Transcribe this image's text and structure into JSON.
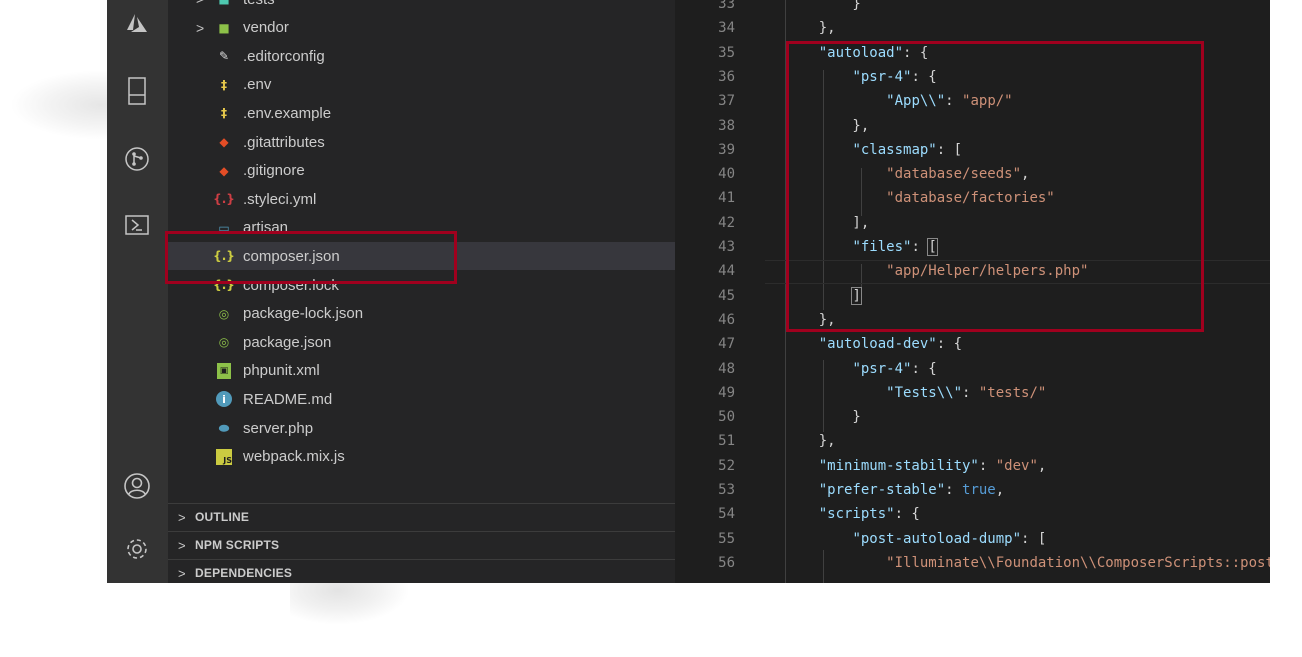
{
  "explorer": {
    "files": [
      {
        "name": "tests",
        "icon": "folder-tests-icon",
        "type": "folder",
        "color": "#4ec9b0"
      },
      {
        "name": "vendor",
        "icon": "folder-vendor-icon",
        "type": "folder",
        "color": "#8dc149"
      },
      {
        "name": ".editorconfig",
        "icon": "editorconfig-icon",
        "type": "file",
        "color": "#dddddd"
      },
      {
        "name": ".env",
        "icon": "env-icon",
        "type": "file",
        "color": "#e6c84b"
      },
      {
        "name": ".env.example",
        "icon": "env-icon",
        "type": "file",
        "color": "#e6c84b"
      },
      {
        "name": ".gitattributes",
        "icon": "git-icon",
        "type": "file",
        "color": "#e44d26"
      },
      {
        "name": ".gitignore",
        "icon": "git-icon",
        "type": "file",
        "color": "#e44d26"
      },
      {
        "name": ".styleci.yml",
        "icon": "yaml-icon",
        "type": "file",
        "color": "#cc3e44"
      },
      {
        "name": "artisan",
        "icon": "file-icon",
        "type": "file",
        "color": "#519aba"
      },
      {
        "name": "composer.json",
        "icon": "json-icon",
        "type": "file",
        "color": "#cbcb41",
        "selected": true
      },
      {
        "name": "composer.lock",
        "icon": "json-icon",
        "type": "file",
        "color": "#cbcb41"
      },
      {
        "name": "package-lock.json",
        "icon": "npm-json-icon",
        "type": "file",
        "color": "#8dc149"
      },
      {
        "name": "package.json",
        "icon": "npm-json-icon",
        "type": "file",
        "color": "#8dc149"
      },
      {
        "name": "phpunit.xml",
        "icon": "xml-icon",
        "type": "file",
        "color": "#8dc149"
      },
      {
        "name": "README.md",
        "icon": "info-icon",
        "type": "file",
        "color": "#519aba"
      },
      {
        "name": "server.php",
        "icon": "php-icon",
        "type": "file",
        "color": "#519aba"
      },
      {
        "name": "webpack.mix.js",
        "icon": "js-icon",
        "type": "file",
        "color": "#cbcb41"
      }
    ],
    "panels": [
      "OUTLINE",
      "NPM SCRIPTS",
      "DEPENDENCIES"
    ]
  },
  "activity_bar": [
    "azure-icon",
    "remote-explorer-icon",
    "git-source-control-icon",
    "terminal-icon",
    "account-icon",
    "settings-gear-icon"
  ],
  "editor": {
    "lines": [
      {
        "n": "33",
        "text": "        }"
      },
      {
        "n": "34",
        "text": "    },"
      },
      {
        "n": "35",
        "text": "    \"autoload\": {"
      },
      {
        "n": "36",
        "text": "        \"psr-4\": {"
      },
      {
        "n": "37",
        "text": "            \"App\\\\\": \"app/\""
      },
      {
        "n": "38",
        "text": "        },"
      },
      {
        "n": "39",
        "text": "        \"classmap\": ["
      },
      {
        "n": "40",
        "text": "            \"database/seeds\","
      },
      {
        "n": "41",
        "text": "            \"database/factories\""
      },
      {
        "n": "42",
        "text": "        ],"
      },
      {
        "n": "43",
        "text": "        \"files\": ["
      },
      {
        "n": "44",
        "text": "            \"app/Helper/helpers.php\""
      },
      {
        "n": "45",
        "text": "        ]"
      },
      {
        "n": "46",
        "text": "    },"
      },
      {
        "n": "47",
        "text": "    \"autoload-dev\": {"
      },
      {
        "n": "48",
        "text": "        \"psr-4\": {"
      },
      {
        "n": "49",
        "text": "            \"Tests\\\\\": \"tests/\""
      },
      {
        "n": "50",
        "text": "        }"
      },
      {
        "n": "51",
        "text": "    },"
      },
      {
        "n": "52",
        "text": "    \"minimum-stability\": \"dev\","
      },
      {
        "n": "53",
        "text": "    \"prefer-stable\": true,"
      },
      {
        "n": "54",
        "text": "    \"scripts\": {"
      },
      {
        "n": "55",
        "text": "        \"post-autoload-dump\": ["
      },
      {
        "n": "56",
        "text": "            \"Illuminate\\\\Foundation\\\\ComposerScripts::postAutoloadDump\","
      }
    ]
  },
  "colors": {
    "highlight_box": "#a0001e",
    "json_key": "#9cdcfe",
    "json_string": "#ce9178",
    "json_keyword": "#569cd6"
  }
}
